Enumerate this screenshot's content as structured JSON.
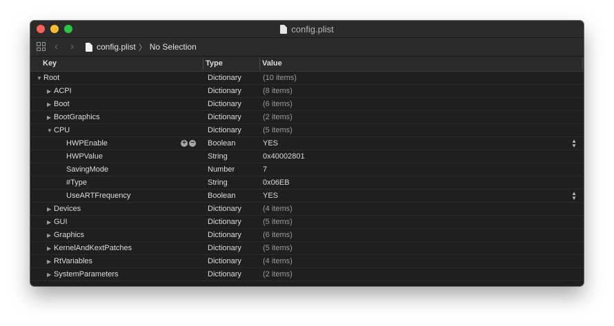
{
  "window": {
    "title": "config.plist"
  },
  "pathbar": {
    "file": "config.plist",
    "selection": "No Selection"
  },
  "columns": {
    "key": "Key",
    "type": "Type",
    "value": "Value"
  },
  "rows": [
    {
      "key": "Root",
      "type": "Dictionary",
      "value": "(10 items)"
    },
    {
      "key": "ACPI",
      "type": "Dictionary",
      "value": "(8 items)"
    },
    {
      "key": "Boot",
      "type": "Dictionary",
      "value": "(6 items)"
    },
    {
      "key": "BootGraphics",
      "type": "Dictionary",
      "value": "(2 items)"
    },
    {
      "key": "CPU",
      "type": "Dictionary",
      "value": "(5 items)"
    },
    {
      "key": "HWPEnable",
      "type": "Boolean",
      "value": "YES"
    },
    {
      "key": "HWPValue",
      "type": "String",
      "value": "0x40002801"
    },
    {
      "key": "SavingMode",
      "type": "Number",
      "value": "7"
    },
    {
      "key": "#Type",
      "type": "String",
      "value": "0x06EB"
    },
    {
      "key": "UseARTFrequency",
      "type": "Boolean",
      "value": "YES"
    },
    {
      "key": "Devices",
      "type": "Dictionary",
      "value": "(4 items)"
    },
    {
      "key": "GUI",
      "type": "Dictionary",
      "value": "(5 items)"
    },
    {
      "key": "Graphics",
      "type": "Dictionary",
      "value": "(6 items)"
    },
    {
      "key": "KernelAndKextPatches",
      "type": "Dictionary",
      "value": "(5 items)"
    },
    {
      "key": "RtVariables",
      "type": "Dictionary",
      "value": "(4 items)"
    },
    {
      "key": "SystemParameters",
      "type": "Dictionary",
      "value": "(2 items)"
    }
  ]
}
